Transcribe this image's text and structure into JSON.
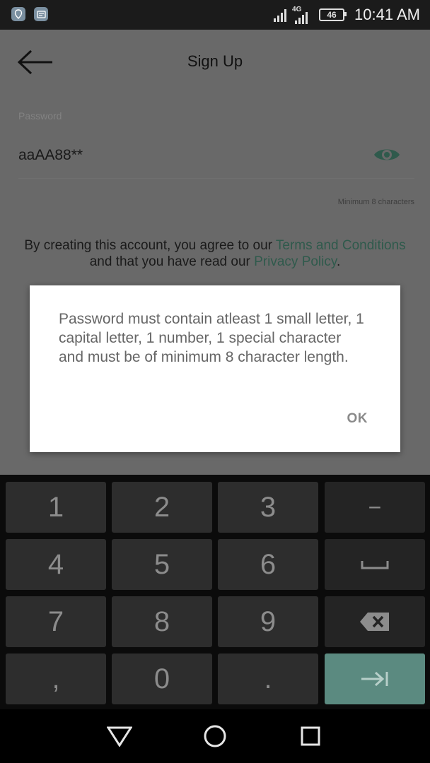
{
  "status_bar": {
    "network_type": "4G",
    "battery": "46",
    "time": "10:41 AM"
  },
  "header": {
    "title": "Sign Up",
    "back_icon": "arrow-left-icon"
  },
  "password_field": {
    "label": "Password",
    "value": "aaAA88**",
    "hint": "Minimum 8 characters",
    "toggle_icon": "eye-icon"
  },
  "agreement": {
    "prefix": "By creating this account, you agree to our ",
    "terms_link": "Terms and Conditions",
    "middle": " and that you have read our ",
    "privacy_link": "Privacy Policy",
    "suffix": "."
  },
  "dialog": {
    "message": "Password must contain atleast 1 small letter, 1 capital letter, 1 number, 1 special character and must be of minimum 8 character length.",
    "ok_label": "OK"
  },
  "keypad": {
    "digits": [
      "1",
      "2",
      "3",
      "4",
      "5",
      "6",
      "7",
      "8",
      "9",
      ",",
      "0",
      "."
    ],
    "minus_label": "−",
    "space_icon": "space-bar-icon",
    "backspace_icon": "backspace-icon",
    "next_icon": "tab-next-icon",
    "accent_color": "#5b8a80"
  },
  "navbar": {
    "back_icon": "triangle-back-icon",
    "home_icon": "circle-home-icon",
    "recents_icon": "square-recents-icon"
  },
  "colors": {
    "link": "#2f5a4c",
    "scrim": "#696969"
  }
}
